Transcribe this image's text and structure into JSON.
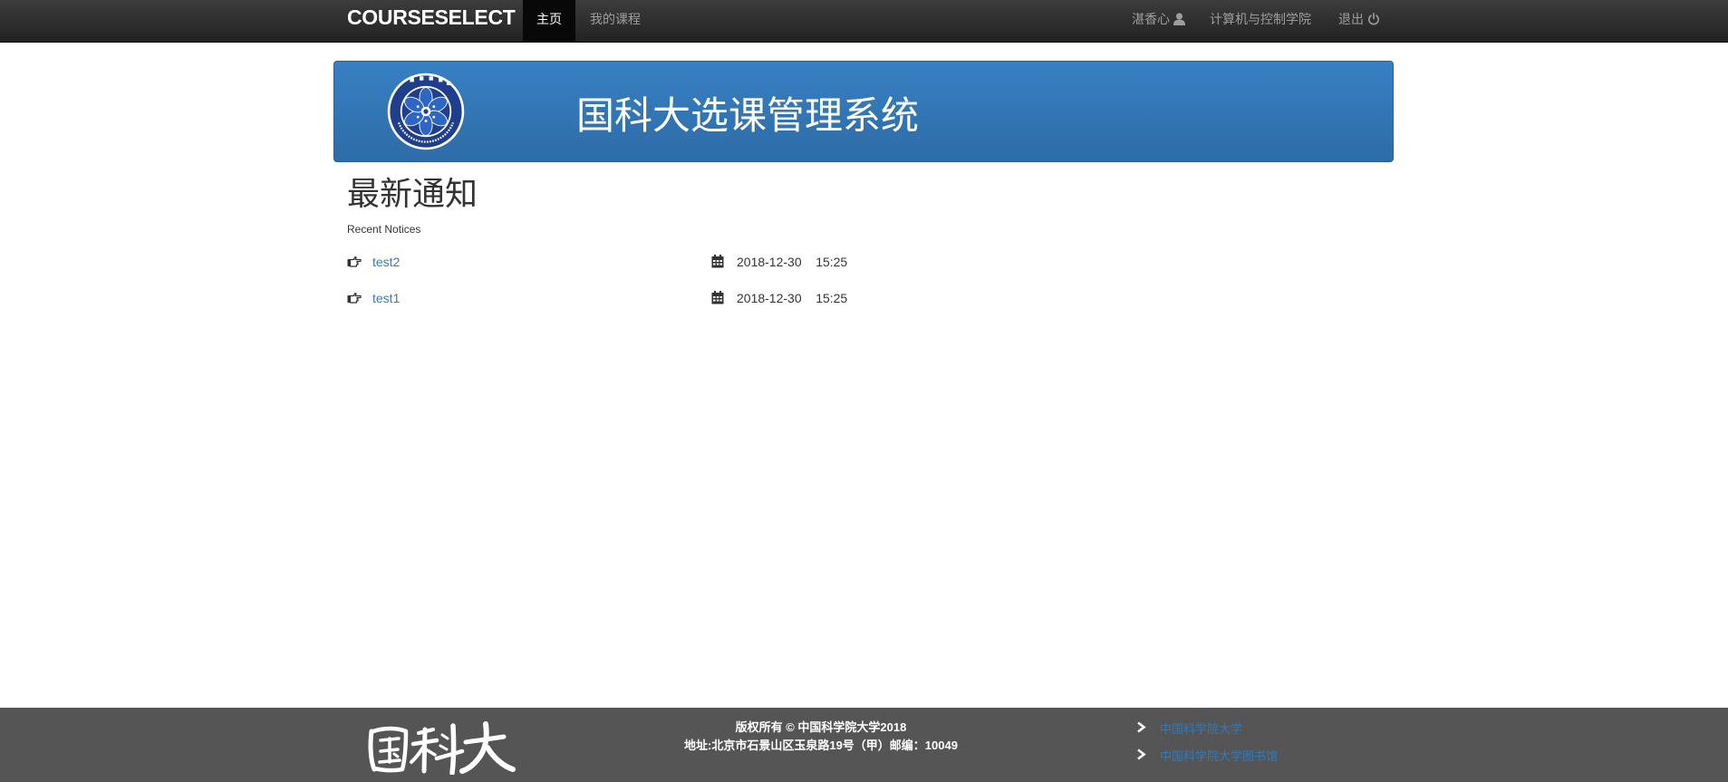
{
  "navbar": {
    "brand": "COURSESELECT",
    "items": [
      {
        "label": "主页",
        "active": true
      },
      {
        "label": "我的课程",
        "active": false
      }
    ],
    "user_name": "湛香心",
    "user_icon": "user-icon",
    "department": "计算机与控制学院",
    "logout_label": "退出",
    "logout_icon": "power-icon"
  },
  "banner": {
    "title": "国科大选课管理系统",
    "emblem_icon": "cas-emblem-icon",
    "emblem_text": "CHINESE ACADEMY OF SCIENCES",
    "emblem_chars": "中国科学院"
  },
  "notices": {
    "title": "最新通知",
    "subtitle": "Recent Notices",
    "items": [
      {
        "label": "test2",
        "date": "2018-12-30",
        "time": "15:25"
      },
      {
        "label": "test1",
        "date": "2018-12-30",
        "time": "15:25"
      }
    ]
  },
  "footer": {
    "logo_text": "国科大",
    "copyright": "版权所有 © 中国科学院大学2018",
    "address": "地址:北京市石景山区玉泉路19号（甲）邮编：10049",
    "links": [
      {
        "label": "中国科学院大学"
      },
      {
        "label": "中国科学院大学图书馆"
      }
    ]
  },
  "colors": {
    "navbar_bg": "#222222",
    "banner_bg": "#337ab7",
    "link": "#337ab7",
    "footer_bg": "#555555"
  }
}
